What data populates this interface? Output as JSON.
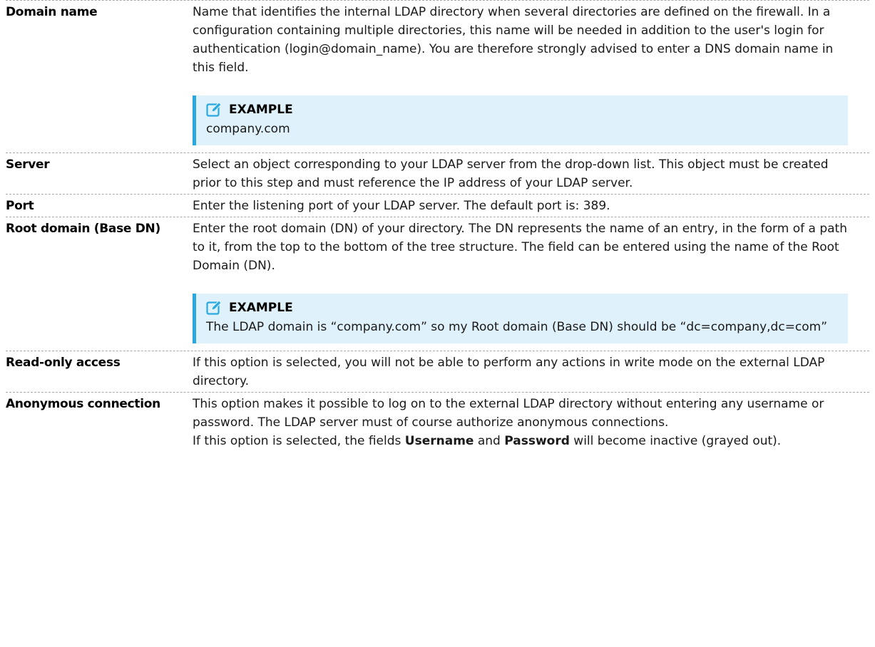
{
  "rows": [
    {
      "term": "Domain name",
      "desc": "Name that identifies the internal LDAP directory when several directories are defined on the firewall. In a configuration containing multiple directories, this name will be needed in addition to the user's login for authentication (login@domain_name). You are therefore strongly advised to enter a DNS domain name in this field.",
      "example": {
        "title": "EXAMPLE",
        "text": "company.com",
        "icon": "edit-icon"
      }
    },
    {
      "term": "Server",
      "desc": "Select an object corresponding to your LDAP server from the drop-down list. This object must be created prior to this step and must reference the IP address of your LDAP server."
    },
    {
      "term": "Port",
      "desc": "Enter the listening port of your LDAP server. The default port is: 389."
    },
    {
      "term": "Root domain (Base DN)",
      "desc": "Enter the root domain (DN) of your directory. The DN represents the name of an entry, in the form of a path to it, from the top to the bottom of the tree structure. The field can be entered using the name of the Root Domain (DN).",
      "example": {
        "title": "EXAMPLE",
        "text": "The LDAP domain is “company.com” so my Root domain (Base DN) should be “dc=company,dc=com”",
        "icon": "edit-icon"
      }
    },
    {
      "term": "Read-only access",
      "desc": "If this option is selected, you will not be able to perform any actions in write mode on the external LDAP directory."
    },
    {
      "term": "Anonymous connection",
      "desc": "This option makes it possible to log on to the external LDAP directory without entering any username or password. The LDAP server must of course authorize anonymous connections.",
      "note_prefix": "If this option is selected, the fields ",
      "note_field1": "Username",
      "note_mid": " and ",
      "note_field2": "Password",
      "note_suffix": " will become inactive (grayed out)."
    }
  ],
  "colors": {
    "accent": "#29a9e0",
    "callout_bg": "#dff1fa"
  }
}
